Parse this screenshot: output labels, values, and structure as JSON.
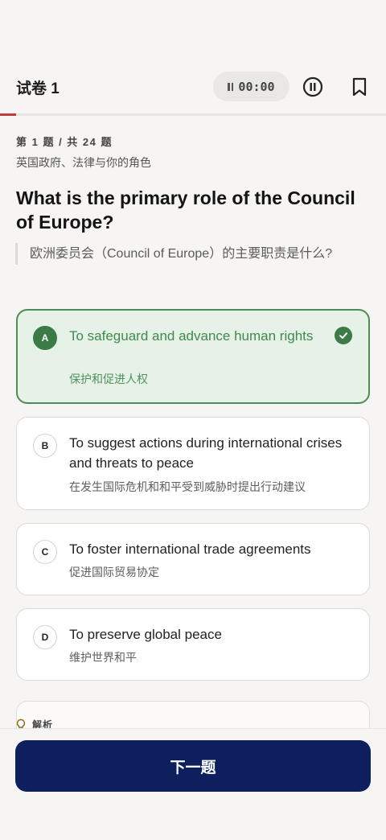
{
  "header": {
    "title": "试卷 1",
    "timer": "00:00",
    "progress": 0.0417
  },
  "question": {
    "meta": "第 1 题 / 共 24 题",
    "category": "英国政府、法律与你的角色",
    "text": "What is the primary role of the Council of Europe?",
    "translation": "欧洲委员会（Council of Europe）的主要职责是什么?"
  },
  "options": [
    {
      "letter": "A",
      "en": "To safeguard and advance human rights",
      "zh": "保护和促进人权",
      "selected": true
    },
    {
      "letter": "B",
      "en": "To suggest actions during international crises and threats to peace",
      "zh": "在发生国际危机和和平受到威胁时提出行动建议",
      "selected": false
    },
    {
      "letter": "C",
      "en": "To foster international trade agreements",
      "zh": "促进国际贸易协定",
      "selected": false
    },
    {
      "letter": "D",
      "en": "To preserve global peace",
      "zh": "维护世界和平",
      "selected": false
    }
  ],
  "explanation": {
    "label": "解析"
  },
  "footer": {
    "next_label": "下一题"
  },
  "colors": {
    "accent": "#c0393b",
    "correct": "#3c7a47",
    "primary_button": "#0d1f5c"
  }
}
